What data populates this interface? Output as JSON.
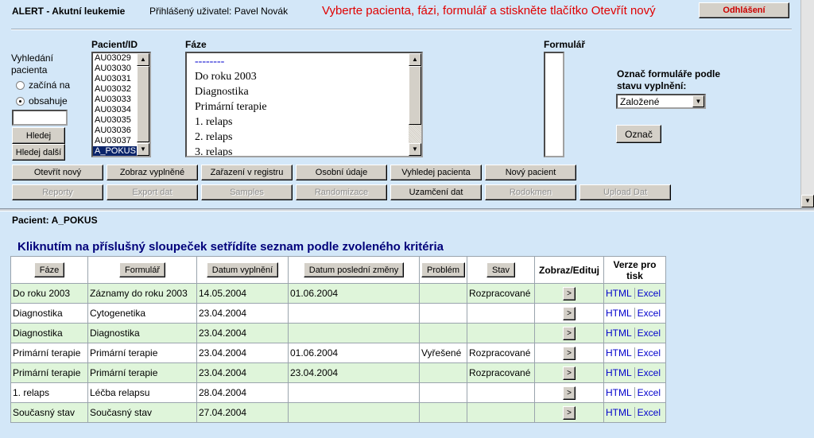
{
  "header": {
    "app_title": "ALERT - Akutní leukemie",
    "user_label": "Přihlášený uživatel: Pavel Novák",
    "instruction": "Vyberte pacienta, fázi, formulář a stiskněte tlačítko Otevřít nový",
    "logout_label": "Odhlášení"
  },
  "search": {
    "label_line1": "Vyhledání",
    "label_line2": "pacienta",
    "radio_starts": "začíná na",
    "radio_contains": "obsahuje",
    "value": "",
    "find_label": "Hledej",
    "find_next_label": "Hledej další"
  },
  "patient": {
    "header": "Pacient/ID",
    "items": [
      "AU03029",
      "AU03030",
      "AU03031",
      "AU03032",
      "AU03033",
      "AU03034",
      "AU03035",
      "AU03036",
      "AU03037",
      "A_POKUS"
    ],
    "selected": "A_POKUS"
  },
  "faze": {
    "header": "Fáze",
    "items": [
      "--------",
      "Do roku 2003",
      "Diagnostika",
      "Primární terapie",
      "1. relaps",
      "2. relaps",
      "3. relaps"
    ]
  },
  "formular": {
    "header": "Formulář"
  },
  "mark": {
    "label_line1": "Označ formuláře podle",
    "label_line2": "stavu vyplnění:",
    "select_value": "Založené",
    "button_label": "Označ"
  },
  "actions": {
    "row1": [
      "Otevřít nový",
      "Zobraz vyplněné",
      "Zařazení v registru",
      "Osobní údaje",
      "Vyhledej pacienta",
      "Nový pacient"
    ],
    "row2": [
      "Reporty",
      "Export dat",
      "Samples",
      "Randomizace",
      "Uzamčení dat",
      "Rodokmen",
      "Upload Dat"
    ]
  },
  "bottom": {
    "patient_line": "Pacient: A_POKUS",
    "sort_hint": "Kliknutím na příslušný sloupeček setřídíte seznam podle zvoleného kritéria",
    "columns": {
      "faze": "Fáze",
      "formular": "Formulář",
      "datum_vyplneni": "Datum vyplnění",
      "datum_zmeny": "Datum poslední změny",
      "problem": "Problém",
      "stav": "Stav",
      "zobraz": "Zobraz/Edituj",
      "verze_line1": "Verze pro",
      "verze_line2": "tisk"
    },
    "rows": [
      {
        "faze": "Do roku 2003",
        "formular": "Záznamy do roku 2003",
        "datum": "14.05.2004",
        "zmena": "01.06.2004",
        "problem": "",
        "stav": "Rozpracované",
        "btn": ">",
        "html": "HTML",
        "excel": "Excel"
      },
      {
        "faze": "Diagnostika",
        "formular": "Cytogenetika",
        "datum": "23.04.2004",
        "zmena": "",
        "problem": "",
        "stav": "",
        "btn": ">",
        "html": "HTML",
        "excel": "Excel"
      },
      {
        "faze": "Diagnostika",
        "formular": "Diagnostika",
        "datum": "23.04.2004",
        "zmena": "",
        "problem": "",
        "stav": "",
        "btn": ">",
        "html": "HTML",
        "excel": "Excel"
      },
      {
        "faze": "Primární terapie",
        "formular": "Primární terapie",
        "datum": "23.04.2004",
        "zmena": "01.06.2004",
        "problem": "Vyřešené",
        "stav": "Rozpracované",
        "btn": ">",
        "html": "HTML",
        "excel": "Excel"
      },
      {
        "faze": "Primární terapie",
        "formular": "Primární terapie",
        "datum": "23.04.2004",
        "zmena": "23.04.2004",
        "problem": "",
        "stav": "Rozpracované",
        "btn": ">",
        "html": "HTML",
        "excel": "Excel"
      },
      {
        "faze": "1. relaps",
        "formular": "Léčba relapsu",
        "datum": "28.04.2004",
        "zmena": "",
        "problem": "",
        "stav": "",
        "btn": ">",
        "html": "HTML",
        "excel": "Excel"
      },
      {
        "faze": "Současný stav",
        "formular": "Současný stav",
        "datum": "27.04.2004",
        "zmena": "",
        "problem": "",
        "stav": "",
        "btn": ">",
        "html": "HTML",
        "excel": "Excel"
      }
    ]
  },
  "colors": {
    "background": "#d3e7f8",
    "instruction": "#e00000",
    "logout_text": "#cc0000",
    "hint_text": "#00007a",
    "row_green": "#dff5da",
    "selection": "#0a246a"
  }
}
